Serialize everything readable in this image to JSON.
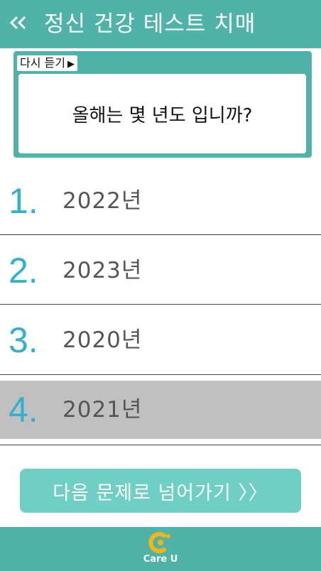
{
  "header": {
    "back_icon": "double-chevron-left-icon",
    "title": "정신 건강 테스트 치매"
  },
  "question": {
    "replay_label": "다시 듣기",
    "replay_icon": "play-icon",
    "text": "올해는 몇 년도 입니까?"
  },
  "options": [
    {
      "number": "1.",
      "label": "2022년"
    },
    {
      "number": "2.",
      "label": "2023년"
    },
    {
      "number": "3.",
      "label": "2020년"
    },
    {
      "number": "4.",
      "label": "2021년"
    }
  ],
  "selected_option_index": 3,
  "next_button": {
    "label": "다음 문제로 넘어가기 〉〉"
  },
  "footer": {
    "logo_text": "Care U"
  },
  "colors": {
    "accent": "#4fb3a9",
    "button": "#6fcfc5",
    "number": "#2fb1cf",
    "selected": "#c0c0c0",
    "logo": "#f5b50e"
  }
}
